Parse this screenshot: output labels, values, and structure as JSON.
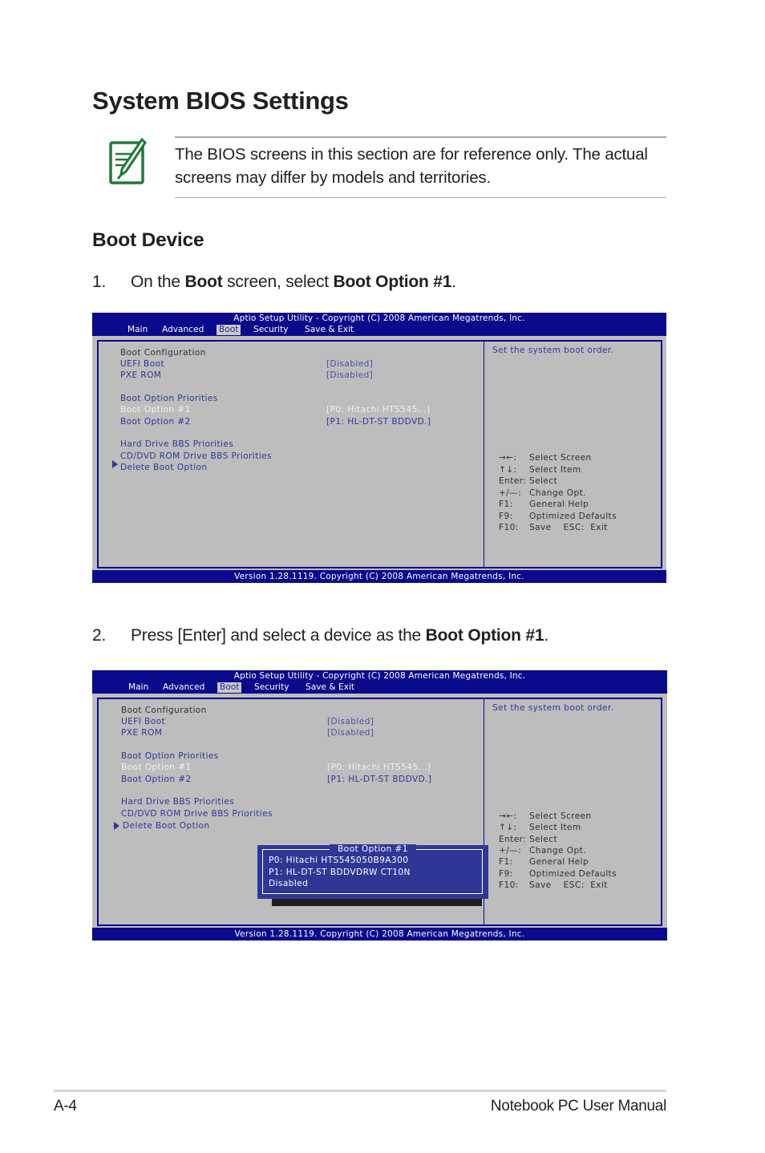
{
  "page": {
    "title": "System BIOS Settings",
    "note": {
      "icon": "note-pencil-icon",
      "text": "The BIOS screens in this section are for reference only. The actual screens may differ by models and territories."
    },
    "section_heading": "Boot Device",
    "steps": [
      {
        "number": "1.",
        "parts": [
          "On the ",
          "Boot",
          " screen, select ",
          "Boot Option #1",
          "."
        ]
      },
      {
        "number": "2.",
        "parts": [
          "Press [Enter] and select a device as the ",
          "Boot Option #1",
          "."
        ]
      }
    ],
    "footer": {
      "page_number": "A-4",
      "manual_title": "Notebook PC User Manual"
    }
  },
  "bios": {
    "title": "Aptio Setup Utility - Copyright (C) 2008 American Megatrends, Inc.",
    "tabs": [
      "Main",
      "Advanced",
      "Boot",
      "Security",
      "Save & Exit"
    ],
    "active_tab": "Boot",
    "items": {
      "boot_configuration": "Boot Configuration",
      "uefi_boot": "UEFI Boot",
      "uefi_boot_value": "[Disabled]",
      "pxe_rom": "PXE ROM",
      "pxe_rom_value": "[Disabled]",
      "boot_option_priorities": "Boot Option Priorities",
      "boot_option_1": "Boot Option #1",
      "boot_option_1_value": "[P0:  Hitachi HTS545...]",
      "boot_option_2": "Boot Option #2",
      "boot_option_2_value": "[P1:  HL-DT-ST BDDVD.]",
      "hdd_bbs": "Hard Drive BBS Priorities",
      "cdrom_bbs": "CD/DVD ROM Drive BBS Priorities",
      "delete_boot_option": "Delete Boot Option"
    },
    "help_text": "Set the system boot order.",
    "key_help": [
      {
        "key": "→←:",
        "action": "Select Screen",
        "icon": "left-right-arrows-icon"
      },
      {
        "key": "↑↓:",
        "action": "Select Item",
        "icon": "up-down-arrows-icon"
      },
      {
        "key": "Enter:",
        "action": "Select"
      },
      {
        "key": "+/—:",
        "action": "Change Opt."
      },
      {
        "key": "F1:",
        "action": "General Help"
      },
      {
        "key": "F9:",
        "action": "Optimized Defaults"
      },
      {
        "key": "F10:",
        "action": "Save    ESC:  Exit"
      }
    ],
    "footer": "Version 1.28.1119. Copyright (C) 2008 American Megatrends, Inc.",
    "popup": {
      "title": "Boot Option #1",
      "options": [
        "P0:  Hitachi HTS545050B9A300",
        "P1:  HL-DT-ST BDDVDRW CT10N",
        "Disabled"
      ]
    }
  },
  "colors": {
    "bios_blue": "#0a0a8c",
    "bios_gray": "#bdbdbd",
    "bios_item_blue": "#2e3796",
    "note_icon_green": "#1f7a3a"
  }
}
